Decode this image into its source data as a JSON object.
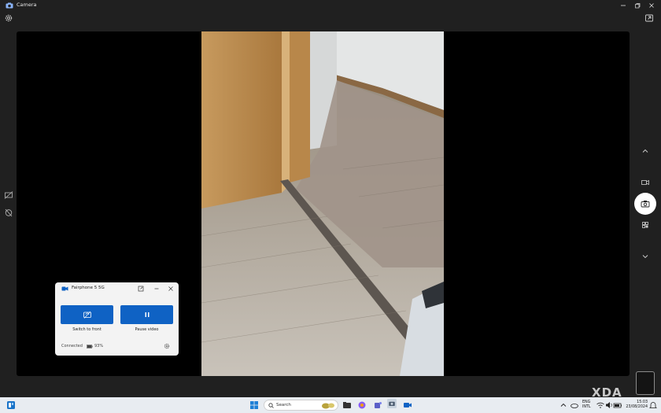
{
  "window": {
    "title": "Camera"
  },
  "popup": {
    "device_name": "Fairphone 5 5G",
    "switch_label": "Switch to front",
    "pause_label": "Pause video",
    "status": "Connected",
    "battery": "93%"
  },
  "taskbar": {
    "search_placeholder": "Search",
    "lang_top": "ENG",
    "lang_bottom": "INTL",
    "time": "15:03",
    "date": "23/08/2024"
  },
  "watermark": "XDA",
  "colors": {
    "accent": "#0f62c4",
    "background": "#202020"
  }
}
